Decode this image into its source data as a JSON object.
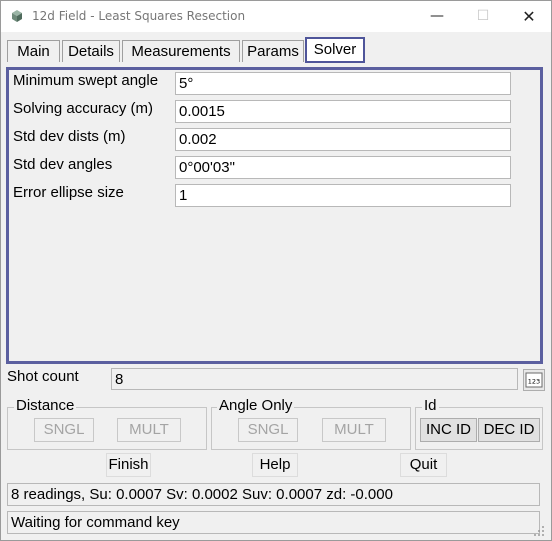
{
  "window": {
    "title": "12d Field - Least Squares Resection",
    "minimize_glyph": "—",
    "maximize_glyph": "☐",
    "close_glyph": "✕"
  },
  "tabs": [
    {
      "label": "Main"
    },
    {
      "label": "Details"
    },
    {
      "label": "Measurements"
    },
    {
      "label": "Params"
    },
    {
      "label": "Solver"
    }
  ],
  "active_tab": "Solver",
  "solver": {
    "fields": [
      {
        "label": "Minimum swept angle",
        "value": "5°"
      },
      {
        "label": "Solving accuracy (m)",
        "value": "0.0015"
      },
      {
        "label": "Std dev dists (m)",
        "value": "0.002"
      },
      {
        "label": "Std dev angles",
        "value": "0°00'03\""
      },
      {
        "label": "Error ellipse size",
        "value": "1"
      }
    ]
  },
  "shot_count": {
    "label": "Shot count",
    "value": "8",
    "calc_icon_text": "123"
  },
  "groups": {
    "distance": {
      "label": "Distance",
      "sngl": "SNGL",
      "mult": "MULT"
    },
    "angle_only": {
      "label": "Angle Only",
      "sngl": "SNGL",
      "mult": "MULT"
    },
    "id": {
      "label": "Id",
      "inc": "INC ID",
      "dec": "DEC ID"
    }
  },
  "actions": {
    "finish": "Finish",
    "help": "Help",
    "quit": "Quit"
  },
  "status": {
    "line1": "8 readings, Su: 0.0007 Sv: 0.0002 Suv: 0.0007 zd: -0.000",
    "line2": "Waiting for command key"
  },
  "colors": {
    "accent": "#5b5f9f",
    "disabled_text": "#a4a4a4"
  }
}
